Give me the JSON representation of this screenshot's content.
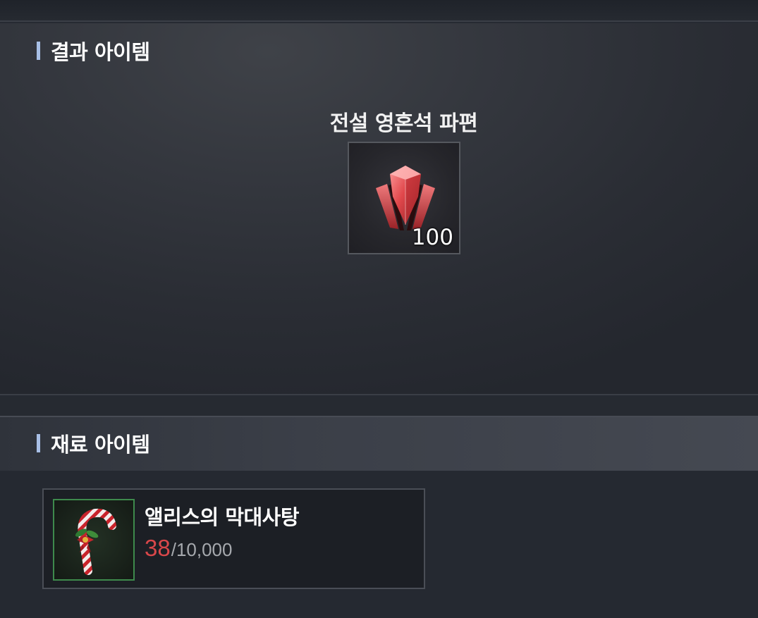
{
  "result_section": {
    "title": "결과 아이템",
    "item": {
      "name": "전설 영혼석 파편",
      "count": "100",
      "icon": "red-crystal-shard-icon"
    }
  },
  "material_section": {
    "title": "재료 아이템",
    "item": {
      "name": "앨리스의 막대사탕",
      "owned": "38",
      "separator": "/",
      "required": "10,000",
      "icon": "candy-cane-icon"
    }
  },
  "colors": {
    "header_bar": "#a8bfe6",
    "owned_insufficient": "#d9474a",
    "material_slot_border": "#3e8a4c"
  }
}
